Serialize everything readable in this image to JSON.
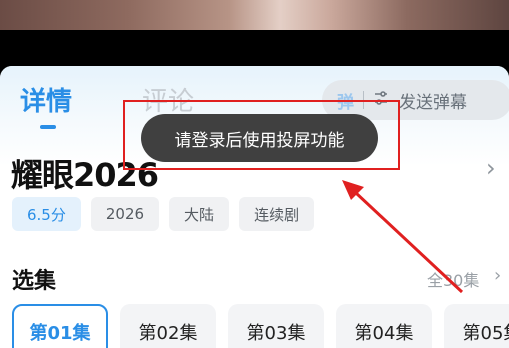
{
  "tabs": [
    {
      "label": "详情",
      "active": true
    },
    {
      "label": "评论",
      "active": false
    }
  ],
  "danmaku": {
    "toggle_label": "弹",
    "settings_icon": "danmaku-settings-icon",
    "send_label": "发送弹幕"
  },
  "drama": {
    "title": "耀眼2026",
    "tags": [
      "6.5分",
      "2026",
      "大陆",
      "连续剧"
    ]
  },
  "episodes_section": {
    "title": "选集",
    "all_label": "全30集",
    "episodes": [
      "第01集",
      "第02集",
      "第03集",
      "第04集",
      "第05集"
    ],
    "selected_index": 0
  },
  "toast": {
    "message": "请登录后使用投屏功能"
  },
  "colors": {
    "accent": "#2a8ee6",
    "annotation": "#e02020"
  }
}
